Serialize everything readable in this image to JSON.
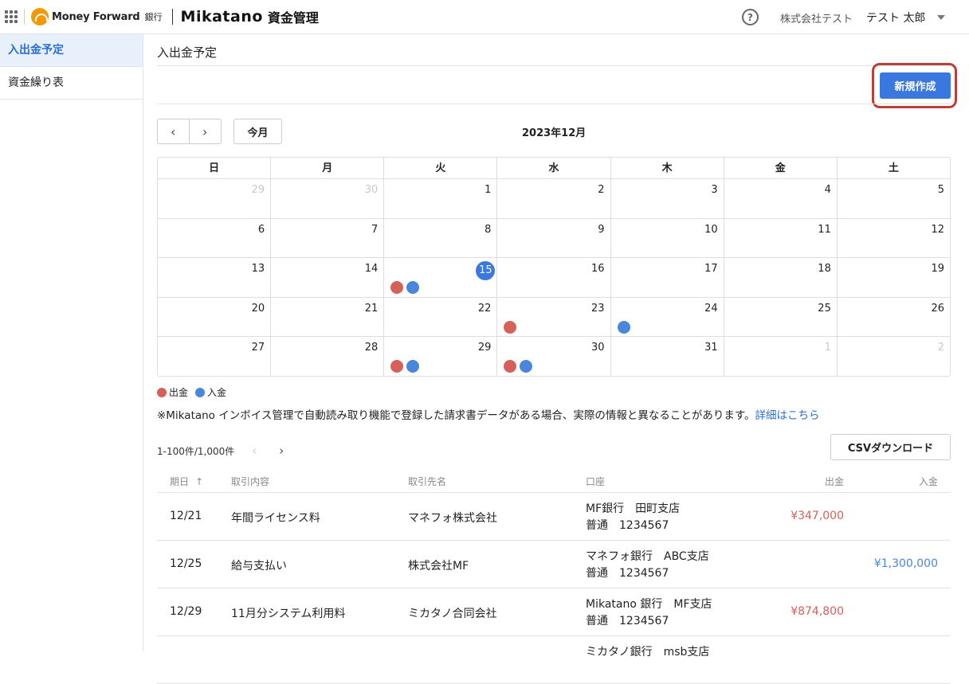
{
  "header": {
    "mf_logo_text": "Money Forward",
    "mf_bank": "銀行",
    "brand": "Mikatano",
    "brand_sub": "資金管理",
    "help": "?",
    "company": "株式会社テスト",
    "username": "テスト 太郎"
  },
  "sidebar": {
    "items": [
      {
        "label": "入出金予定"
      },
      {
        "label": "資金繰り表"
      }
    ]
  },
  "page": {
    "title": "入出金予定",
    "new_button": "新規作成"
  },
  "calendar": {
    "prev": "‹",
    "next": "›",
    "today_button": "今月",
    "month_title": "2023年12月",
    "weekdays": [
      "日",
      "月",
      "火",
      "水",
      "木",
      "金",
      "土"
    ],
    "weeks": [
      [
        {
          "d": "29",
          "other": true
        },
        {
          "d": "30",
          "other": true
        },
        {
          "d": "1"
        },
        {
          "d": "2"
        },
        {
          "d": "3"
        },
        {
          "d": "4"
        },
        {
          "d": "5"
        }
      ],
      [
        {
          "d": "6"
        },
        {
          "d": "7"
        },
        {
          "d": "8"
        },
        {
          "d": "9"
        },
        {
          "d": "10"
        },
        {
          "d": "11"
        },
        {
          "d": "12"
        }
      ],
      [
        {
          "d": "13"
        },
        {
          "d": "14"
        },
        {
          "d": "15",
          "today": true,
          "dots": [
            "out",
            "in"
          ]
        },
        {
          "d": "16"
        },
        {
          "d": "17"
        },
        {
          "d": "18"
        },
        {
          "d": "19"
        }
      ],
      [
        {
          "d": "20"
        },
        {
          "d": "21"
        },
        {
          "d": "22"
        },
        {
          "d": "23",
          "dots": [
            "out"
          ]
        },
        {
          "d": "24",
          "dots": [
            "in"
          ]
        },
        {
          "d": "25"
        },
        {
          "d": "26"
        }
      ],
      [
        {
          "d": "27"
        },
        {
          "d": "28"
        },
        {
          "d": "29",
          "dots": [
            "out",
            "in"
          ]
        },
        {
          "d": "30",
          "dots": [
            "out",
            "in"
          ]
        },
        {
          "d": "31"
        },
        {
          "d": "1",
          "other": true
        },
        {
          "d": "2",
          "other": true
        }
      ]
    ],
    "colors": {
      "out": "#d5615a",
      "in": "#4a86dc"
    }
  },
  "legend": {
    "out": "出金",
    "in": "入金"
  },
  "notice": {
    "text": "※Mikatano インボイス管理で自動読み取り機能で登録した請求書データがある場合、実際の情報と異なることがあります。",
    "link": "詳細はこちら"
  },
  "pager": {
    "range": "1-100件/1,000件",
    "prev": "‹",
    "next": "›"
  },
  "csv_button": "CSVダウンロード",
  "table": {
    "headers": {
      "date": "期日",
      "sort": "↑",
      "desc": "取引内容",
      "partner": "取引先名",
      "account": "口座",
      "out": "出金",
      "in": "入金"
    },
    "rows": [
      {
        "date": "12/21",
        "desc": "年間ライセンス料",
        "partner": "マネフォ株式会社",
        "bank": "MF銀行　田町支店",
        "acct": "普通　1234567",
        "out": "¥347,000",
        "in": ""
      },
      {
        "date": "12/25",
        "desc": "給与支払い",
        "partner": "株式会社MF",
        "bank": "マネフォ銀行　ABC支店",
        "acct": "普通　1234567",
        "out": "",
        "in": "¥1,300,000"
      },
      {
        "date": "12/29",
        "desc": "11月分システム利用料",
        "partner": "ミカタノ合同会社",
        "bank": "Mikatano 銀行　MF支店",
        "acct": "普通　1234567",
        "out": "¥874,800",
        "in": ""
      },
      {
        "date": "",
        "desc": "",
        "partner": "",
        "bank": "ミカタノ銀行　msb支店",
        "acct": "",
        "out": "",
        "in": ""
      }
    ]
  }
}
